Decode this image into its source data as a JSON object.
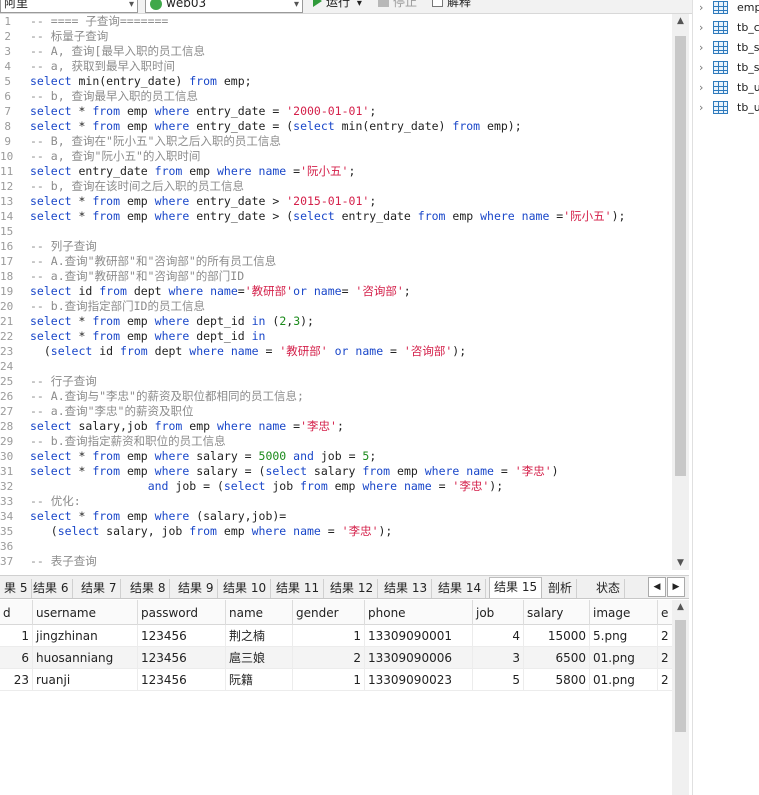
{
  "toolbar": {
    "connection": "阿里",
    "database": "web03",
    "run_label": "运行",
    "stop_label": "停止",
    "explain_label": "解释"
  },
  "editor": {
    "lines": [
      {
        "n": "1",
        "tokens": [
          {
            "t": "-- ==== 子查询=======",
            "c": "cm"
          }
        ]
      },
      {
        "n": "2",
        "tokens": [
          {
            "t": "-- 标量子查询",
            "c": "cm"
          }
        ]
      },
      {
        "n": "3",
        "tokens": [
          {
            "t": "-- A, 查询[最早入职的员工信息",
            "c": "cm"
          }
        ]
      },
      {
        "n": "4",
        "tokens": [
          {
            "t": "-- a, 获取到最早入职时间",
            "c": "cm"
          }
        ]
      },
      {
        "n": "5",
        "tokens": [
          {
            "t": "select",
            "c": "kw"
          },
          {
            "t": " min(entry_date) ",
            "c": "tx"
          },
          {
            "t": "from",
            "c": "kw"
          },
          {
            "t": " emp;",
            "c": "tx"
          }
        ]
      },
      {
        "n": "6",
        "tokens": [
          {
            "t": "-- b, 查询最早入职的员工信息",
            "c": "cm"
          }
        ]
      },
      {
        "n": "7",
        "tokens": [
          {
            "t": "select",
            "c": "kw"
          },
          {
            "t": " * ",
            "c": "tx"
          },
          {
            "t": "from",
            "c": "kw"
          },
          {
            "t": " emp ",
            "c": "tx"
          },
          {
            "t": "where",
            "c": "kw"
          },
          {
            "t": " entry_date = ",
            "c": "tx"
          },
          {
            "t": "'2000-01-01'",
            "c": "st"
          },
          {
            "t": ";",
            "c": "tx"
          }
        ]
      },
      {
        "n": "8",
        "tokens": [
          {
            "t": "select",
            "c": "kw"
          },
          {
            "t": " * ",
            "c": "tx"
          },
          {
            "t": "from",
            "c": "kw"
          },
          {
            "t": " emp ",
            "c": "tx"
          },
          {
            "t": "where",
            "c": "kw"
          },
          {
            "t": " entry_date = (",
            "c": "tx"
          },
          {
            "t": "select",
            "c": "kw"
          },
          {
            "t": " min(entry_date) ",
            "c": "tx"
          },
          {
            "t": "from",
            "c": "kw"
          },
          {
            "t": " emp);",
            "c": "tx"
          }
        ]
      },
      {
        "n": "9",
        "tokens": [
          {
            "t": "-- B, 查询在\"阮小五\"入职之后入职的员工信息",
            "c": "cm"
          }
        ]
      },
      {
        "n": "10",
        "tokens": [
          {
            "t": "-- a, 查询\"阮小五\"的入职时间",
            "c": "cm"
          }
        ]
      },
      {
        "n": "11",
        "tokens": [
          {
            "t": "select",
            "c": "kw"
          },
          {
            "t": " entry_date ",
            "c": "tx"
          },
          {
            "t": "from",
            "c": "kw"
          },
          {
            "t": " emp ",
            "c": "tx"
          },
          {
            "t": "where",
            "c": "kw"
          },
          {
            "t": " ",
            "c": "tx"
          },
          {
            "t": "name",
            "c": "kw"
          },
          {
            "t": " =",
            "c": "tx"
          },
          {
            "t": "'阮小五'",
            "c": "st"
          },
          {
            "t": ";",
            "c": "tx"
          }
        ]
      },
      {
        "n": "12",
        "tokens": [
          {
            "t": "-- b, 查询在该时间之后入职的员工信息",
            "c": "cm"
          }
        ]
      },
      {
        "n": "13",
        "tokens": [
          {
            "t": "select",
            "c": "kw"
          },
          {
            "t": " * ",
            "c": "tx"
          },
          {
            "t": "from",
            "c": "kw"
          },
          {
            "t": " emp ",
            "c": "tx"
          },
          {
            "t": "where",
            "c": "kw"
          },
          {
            "t": " entry_date > ",
            "c": "tx"
          },
          {
            "t": "'2015-01-01'",
            "c": "st"
          },
          {
            "t": ";",
            "c": "tx"
          }
        ]
      },
      {
        "n": "14",
        "tokens": [
          {
            "t": "select",
            "c": "kw"
          },
          {
            "t": " * ",
            "c": "tx"
          },
          {
            "t": "from",
            "c": "kw"
          },
          {
            "t": " emp ",
            "c": "tx"
          },
          {
            "t": "where",
            "c": "kw"
          },
          {
            "t": " entry_date > (",
            "c": "tx"
          },
          {
            "t": "select",
            "c": "kw"
          },
          {
            "t": " entry_date ",
            "c": "tx"
          },
          {
            "t": "from",
            "c": "kw"
          },
          {
            "t": " emp ",
            "c": "tx"
          },
          {
            "t": "where",
            "c": "kw"
          },
          {
            "t": " ",
            "c": "tx"
          },
          {
            "t": "name",
            "c": "kw"
          },
          {
            "t": " =",
            "c": "tx"
          },
          {
            "t": "'阮小五'",
            "c": "st"
          },
          {
            "t": ");",
            "c": "tx"
          }
        ]
      },
      {
        "n": "15",
        "tokens": []
      },
      {
        "n": "16",
        "tokens": [
          {
            "t": "-- 列子查询",
            "c": "cm"
          }
        ]
      },
      {
        "n": "17",
        "tokens": [
          {
            "t": "-- A.查询\"教研部\"和\"咨询部\"的所有员工信息",
            "c": "cm"
          }
        ]
      },
      {
        "n": "18",
        "tokens": [
          {
            "t": "-- a.查询\"教研部\"和\"咨询部\"的部门ID",
            "c": "cm"
          }
        ]
      },
      {
        "n": "19",
        "tokens": [
          {
            "t": "select",
            "c": "kw"
          },
          {
            "t": " id ",
            "c": "tx"
          },
          {
            "t": "from",
            "c": "kw"
          },
          {
            "t": " dept ",
            "c": "tx"
          },
          {
            "t": "where",
            "c": "kw"
          },
          {
            "t": " ",
            "c": "tx"
          },
          {
            "t": "name",
            "c": "kw"
          },
          {
            "t": "=",
            "c": "tx"
          },
          {
            "t": "'教研部'",
            "c": "st"
          },
          {
            "t": "or",
            "c": "kw"
          },
          {
            "t": " ",
            "c": "tx"
          },
          {
            "t": "name",
            "c": "kw"
          },
          {
            "t": "= ",
            "c": "tx"
          },
          {
            "t": "'咨询部'",
            "c": "st"
          },
          {
            "t": ";",
            "c": "tx"
          }
        ]
      },
      {
        "n": "20",
        "tokens": [
          {
            "t": "-- b.查询指定部门ID的员工信息",
            "c": "cm"
          }
        ]
      },
      {
        "n": "21",
        "tokens": [
          {
            "t": "select",
            "c": "kw"
          },
          {
            "t": " * ",
            "c": "tx"
          },
          {
            "t": "from",
            "c": "kw"
          },
          {
            "t": " emp ",
            "c": "tx"
          },
          {
            "t": "where",
            "c": "kw"
          },
          {
            "t": " dept_id ",
            "c": "tx"
          },
          {
            "t": "in",
            "c": "kw"
          },
          {
            "t": " (",
            "c": "tx"
          },
          {
            "t": "2",
            "c": "nm"
          },
          {
            "t": ",",
            "c": "tx"
          },
          {
            "t": "3",
            "c": "nm"
          },
          {
            "t": ");",
            "c": "tx"
          }
        ]
      },
      {
        "n": "22",
        "tokens": [
          {
            "t": "select",
            "c": "kw"
          },
          {
            "t": " * ",
            "c": "tx"
          },
          {
            "t": "from",
            "c": "kw"
          },
          {
            "t": " emp ",
            "c": "tx"
          },
          {
            "t": "where",
            "c": "kw"
          },
          {
            "t": " dept_id ",
            "c": "tx"
          },
          {
            "t": "in",
            "c": "kw"
          }
        ]
      },
      {
        "n": "23",
        "tokens": [
          {
            "t": "  (",
            "c": "tx"
          },
          {
            "t": "select",
            "c": "kw"
          },
          {
            "t": " id ",
            "c": "tx"
          },
          {
            "t": "from",
            "c": "kw"
          },
          {
            "t": " dept ",
            "c": "tx"
          },
          {
            "t": "where",
            "c": "kw"
          },
          {
            "t": " ",
            "c": "tx"
          },
          {
            "t": "name",
            "c": "kw"
          },
          {
            "t": " = ",
            "c": "tx"
          },
          {
            "t": "'教研部'",
            "c": "st"
          },
          {
            "t": " ",
            "c": "tx"
          },
          {
            "t": "or",
            "c": "kw"
          },
          {
            "t": " ",
            "c": "tx"
          },
          {
            "t": "name",
            "c": "kw"
          },
          {
            "t": " = ",
            "c": "tx"
          },
          {
            "t": "'咨询部'",
            "c": "st"
          },
          {
            "t": ");",
            "c": "tx"
          }
        ]
      },
      {
        "n": "24",
        "tokens": []
      },
      {
        "n": "25",
        "tokens": [
          {
            "t": "-- 行子查询",
            "c": "cm"
          }
        ]
      },
      {
        "n": "26",
        "tokens": [
          {
            "t": "-- A.查询与\"李忠\"的薪资及职位都相同的员工信息;",
            "c": "cm"
          }
        ]
      },
      {
        "n": "27",
        "tokens": [
          {
            "t": "-- a.查询\"李忠\"的薪资及职位",
            "c": "cm"
          }
        ]
      },
      {
        "n": "28",
        "tokens": [
          {
            "t": "select",
            "c": "kw"
          },
          {
            "t": " salary,job ",
            "c": "tx"
          },
          {
            "t": "from",
            "c": "kw"
          },
          {
            "t": " emp ",
            "c": "tx"
          },
          {
            "t": "where",
            "c": "kw"
          },
          {
            "t": " ",
            "c": "tx"
          },
          {
            "t": "name",
            "c": "kw"
          },
          {
            "t": " =",
            "c": "tx"
          },
          {
            "t": "'李忠'",
            "c": "st"
          },
          {
            "t": ";",
            "c": "tx"
          }
        ]
      },
      {
        "n": "29",
        "tokens": [
          {
            "t": "-- b.查询指定薪资和职位的员工信息",
            "c": "cm"
          }
        ]
      },
      {
        "n": "30",
        "tokens": [
          {
            "t": "select",
            "c": "kw"
          },
          {
            "t": " * ",
            "c": "tx"
          },
          {
            "t": "from",
            "c": "kw"
          },
          {
            "t": " emp ",
            "c": "tx"
          },
          {
            "t": "where",
            "c": "kw"
          },
          {
            "t": " salary = ",
            "c": "tx"
          },
          {
            "t": "5000",
            "c": "nm"
          },
          {
            "t": " ",
            "c": "tx"
          },
          {
            "t": "and",
            "c": "kw"
          },
          {
            "t": " job = ",
            "c": "tx"
          },
          {
            "t": "5",
            "c": "nm"
          },
          {
            "t": ";",
            "c": "tx"
          }
        ]
      },
      {
        "n": "31",
        "tokens": [
          {
            "t": "select",
            "c": "kw"
          },
          {
            "t": " * ",
            "c": "tx"
          },
          {
            "t": "from",
            "c": "kw"
          },
          {
            "t": " emp ",
            "c": "tx"
          },
          {
            "t": "where",
            "c": "kw"
          },
          {
            "t": " salary = (",
            "c": "tx"
          },
          {
            "t": "select",
            "c": "kw"
          },
          {
            "t": " salary ",
            "c": "tx"
          },
          {
            "t": "from",
            "c": "kw"
          },
          {
            "t": " emp ",
            "c": "tx"
          },
          {
            "t": "where",
            "c": "kw"
          },
          {
            "t": " ",
            "c": "tx"
          },
          {
            "t": "name",
            "c": "kw"
          },
          {
            "t": " = ",
            "c": "tx"
          },
          {
            "t": "'李忠'",
            "c": "st"
          },
          {
            "t": ")",
            "c": "tx"
          }
        ]
      },
      {
        "n": "32",
        "tokens": [
          {
            "t": "                 ",
            "c": "tx"
          },
          {
            "t": "and",
            "c": "kw"
          },
          {
            "t": " job = (",
            "c": "tx"
          },
          {
            "t": "select",
            "c": "kw"
          },
          {
            "t": " job ",
            "c": "tx"
          },
          {
            "t": "from",
            "c": "kw"
          },
          {
            "t": " emp ",
            "c": "tx"
          },
          {
            "t": "where",
            "c": "kw"
          },
          {
            "t": " ",
            "c": "tx"
          },
          {
            "t": "name",
            "c": "kw"
          },
          {
            "t": " = ",
            "c": "tx"
          },
          {
            "t": "'李忠'",
            "c": "st"
          },
          {
            "t": ");",
            "c": "tx"
          }
        ]
      },
      {
        "n": "33",
        "tokens": [
          {
            "t": "-- 优化:",
            "c": "cm"
          }
        ]
      },
      {
        "n": "34",
        "tokens": [
          {
            "t": "select",
            "c": "kw"
          },
          {
            "t": " * ",
            "c": "tx"
          },
          {
            "t": "from",
            "c": "kw"
          },
          {
            "t": " emp ",
            "c": "tx"
          },
          {
            "t": "where",
            "c": "kw"
          },
          {
            "t": " (salary,job)=",
            "c": "tx"
          }
        ]
      },
      {
        "n": "35",
        "tokens": [
          {
            "t": "   (",
            "c": "tx"
          },
          {
            "t": "select",
            "c": "kw"
          },
          {
            "t": " salary, job ",
            "c": "tx"
          },
          {
            "t": "from",
            "c": "kw"
          },
          {
            "t": " emp ",
            "c": "tx"
          },
          {
            "t": "where",
            "c": "kw"
          },
          {
            "t": " ",
            "c": "tx"
          },
          {
            "t": "name",
            "c": "kw"
          },
          {
            "t": " = ",
            "c": "tx"
          },
          {
            "t": "'李忠'",
            "c": "st"
          },
          {
            "t": ");",
            "c": "tx"
          }
        ]
      },
      {
        "n": "36",
        "tokens": []
      },
      {
        "n": "37",
        "tokens": [
          {
            "t": "-- 表子查询",
            "c": "cm"
          }
        ]
      }
    ]
  },
  "result_tabs": [
    {
      "label": "果 5",
      "active": false
    },
    {
      "label": "结果 6",
      "active": false
    },
    {
      "label": "结果 7",
      "active": false
    },
    {
      "label": "结果 8",
      "active": false
    },
    {
      "label": "结果 9",
      "active": false
    },
    {
      "label": "结果 10",
      "active": false
    },
    {
      "label": "结果 11",
      "active": false
    },
    {
      "label": "结果 12",
      "active": false
    },
    {
      "label": "结果 13",
      "active": false
    },
    {
      "label": "结果 14",
      "active": false
    },
    {
      "label": "结果 15",
      "active": true
    },
    {
      "label": "剖析",
      "active": false
    },
    {
      "label": "状态",
      "active": false
    }
  ],
  "grid": {
    "columns": [
      "d",
      "username",
      "password",
      "name",
      "gender",
      "phone",
      "job",
      "salary",
      "image",
      "e"
    ],
    "rows": [
      [
        "1",
        "jingzhinan",
        "123456",
        "荆之楠",
        "1",
        "13309090001",
        "4",
        "15000",
        "5.png",
        "2"
      ],
      [
        "6",
        "huosanniang",
        "123456",
        "扈三娘",
        "2",
        "13309090006",
        "3",
        "6500",
        "01.png",
        "2"
      ],
      [
        "23",
        "ruanji",
        "123456",
        "阮籍",
        "1",
        "13309090023",
        "5",
        "5800",
        "01.png",
        "2"
      ]
    ]
  },
  "tables_panel": {
    "items": [
      "emp_",
      "tb_co",
      "tb_st",
      "tb_st",
      "tb_us",
      "tb_us"
    ]
  }
}
